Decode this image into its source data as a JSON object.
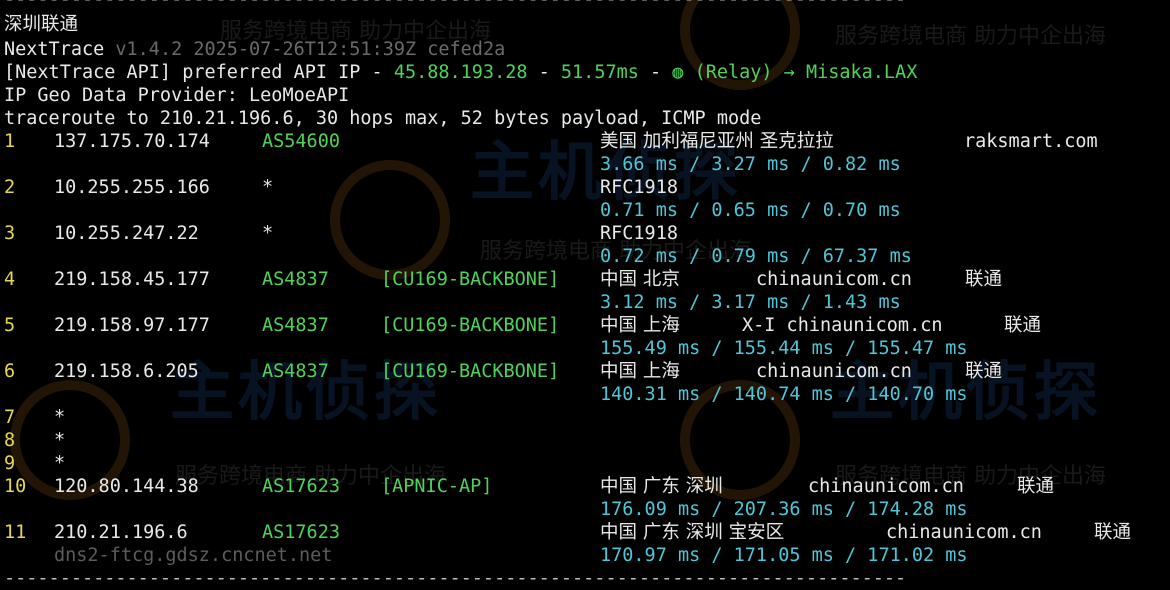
{
  "window": {
    "title": "深圳联通",
    "separator": "-----------------------------------------------------------------------------------------------------------"
  },
  "header": {
    "app_name": "NextTrace",
    "version_info": "v1.4.2 2025-07-26T12:51:39Z cefed2a",
    "api_prefix": "[NextTrace API] preferred API IP - ",
    "api_ip": "45.88.193.28",
    "api_dash1": " - ",
    "api_latency": "51.57ms",
    "api_dash2": " - ",
    "api_relay_icon": "relay-icon",
    "api_relay": "(Relay) → Misaka.LAX",
    "geo_provider": "IP Geo Data Provider: LeoMoeAPI",
    "traceroute": "traceroute to 210.21.196.6, 30 hops max, 52 bytes payload, ICMP mode"
  },
  "hops": [
    {
      "num": "1",
      "ip": "137.175.70.174",
      "asn": "AS54600",
      "tag": "",
      "geo": "美国 加利福尼亚州 圣克拉拉",
      "domain": "raksmart.com",
      "isp": "",
      "rtt": "3.66 ms / 3.27 ms / 0.82 ms",
      "rdns": ""
    },
    {
      "num": "2",
      "ip": "10.255.255.166",
      "asn": "*",
      "tag": "",
      "geo": "RFC1918",
      "domain": "",
      "isp": "",
      "rtt": "0.71 ms / 0.65 ms / 0.70 ms",
      "rdns": ""
    },
    {
      "num": "3",
      "ip": "10.255.247.22",
      "asn": "*",
      "tag": "",
      "geo": "RFC1918",
      "domain": "",
      "isp": "",
      "rtt": "0.72 ms / 0.79 ms / 67.37 ms",
      "rdns": ""
    },
    {
      "num": "4",
      "ip": "219.158.45.177",
      "asn": "AS4837",
      "tag": "[CU169-BACKBONE]",
      "geo": "中国 北京",
      "domain": "chinaunicom.cn",
      "isp": "联通",
      "rtt": "3.12 ms / 3.17 ms / 1.43 ms",
      "rdns": ""
    },
    {
      "num": "5",
      "ip": "219.158.97.177",
      "asn": "AS4837",
      "tag": "[CU169-BACKBONE]",
      "geo": "中国 上海",
      "domain": "X-I chinaunicom.cn",
      "isp": "联通",
      "rtt": "155.49 ms / 155.44 ms / 155.47 ms",
      "rdns": ""
    },
    {
      "num": "6",
      "ip": "219.158.6.205",
      "asn": "AS4837",
      "tag": "[CU169-BACKBONE]",
      "geo": "中国 上海",
      "domain": "chinaunicom.cn",
      "isp": "联通",
      "rtt": "140.31 ms / 140.74 ms / 140.70 ms",
      "rdns": ""
    },
    {
      "num": "10",
      "ip": "120.80.144.38",
      "asn": "AS17623",
      "tag": "[APNIC-AP]",
      "geo": "中国 广东 深圳",
      "domain": "chinaunicom.cn",
      "isp": "联通",
      "rtt": "176.09 ms / 207.36 ms / 174.28 ms",
      "rdns": ""
    },
    {
      "num": "11",
      "ip": "210.21.196.6",
      "asn": "AS17623",
      "tag": "",
      "geo": "中国 广东 深圳 宝安区",
      "domain": "chinaunicom.cn",
      "isp": "联通",
      "rtt": "170.97 ms / 171.05 ms / 171.02 ms",
      "rdns": "dns2-ftcg.gdsz.cncnet.net"
    }
  ],
  "timeouts": [
    {
      "num": "7",
      "mark": "*"
    },
    {
      "num": "8",
      "mark": "*"
    },
    {
      "num": "9",
      "mark": "*"
    }
  ],
  "watermark": {
    "brand": "主机侦探",
    "slogan": "服务跨境电商 助力中企出海"
  },
  "colors": {
    "background": "#000000",
    "hop_number": "#e6d84f",
    "asn": "#4fd25a",
    "rtt": "#4fc6d8",
    "text": "#e8e8e8",
    "watermark_brand": "#2b6cc4",
    "watermark_logo": "#c4731f"
  }
}
